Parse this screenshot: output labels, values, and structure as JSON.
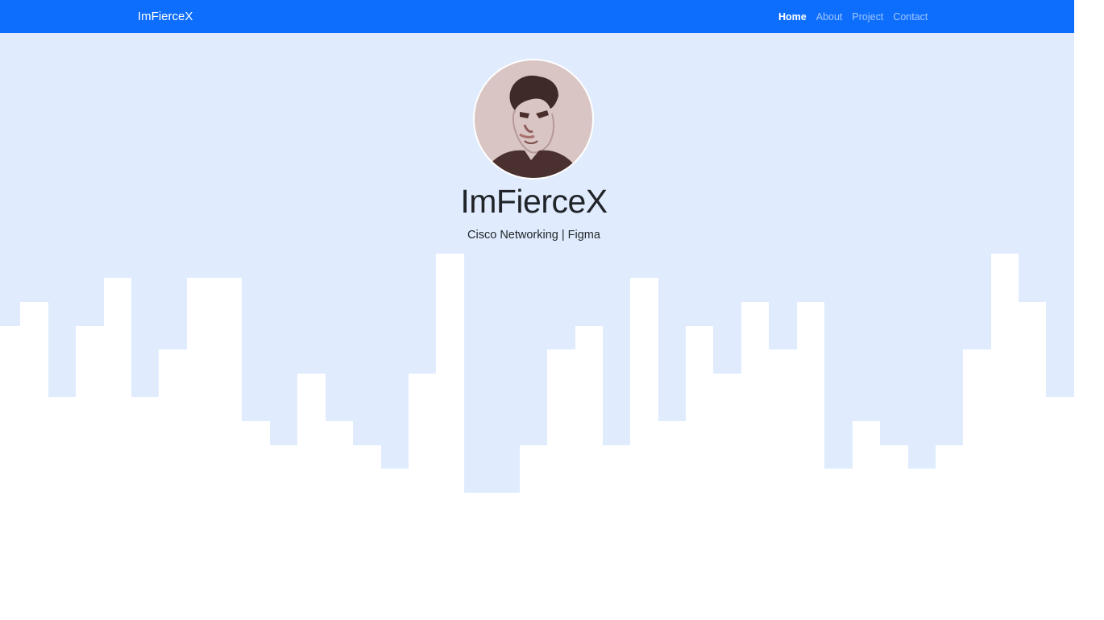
{
  "navbar": {
    "brand": "ImFierceX",
    "links": [
      {
        "label": "Home",
        "active": true
      },
      {
        "label": "About",
        "active": false
      },
      {
        "label": "Project",
        "active": false
      },
      {
        "label": "Contact",
        "active": false
      }
    ]
  },
  "hero": {
    "avatar": "profile-photo",
    "title": "ImFierceX",
    "subtitle": "Cisco Networking | Figma"
  },
  "colors": {
    "navbar": "#0d6efd",
    "hero_background": "#e0ecfe",
    "skyline": "#ffffff"
  }
}
